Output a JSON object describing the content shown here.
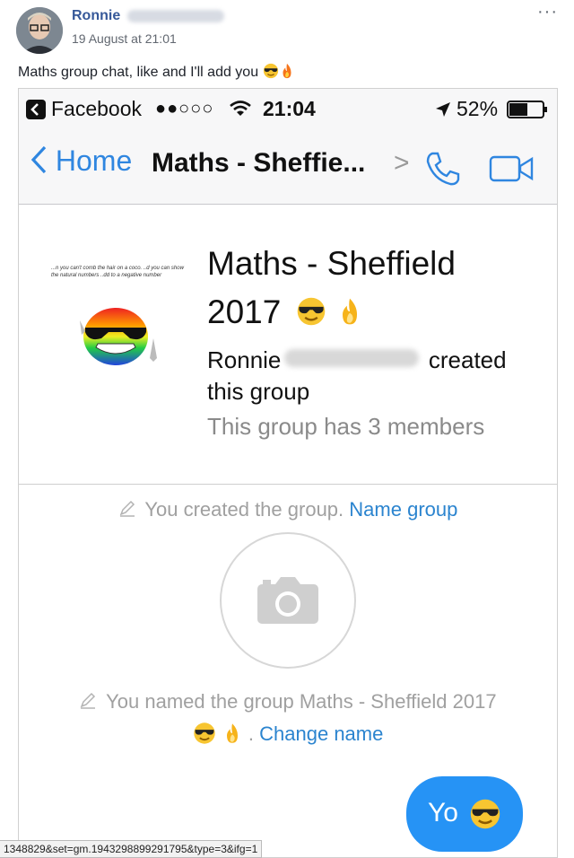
{
  "post": {
    "author": "Ronnie",
    "timestamp": "19 August at 21:01",
    "text": "Maths group chat, like and I'll add you",
    "more": "···"
  },
  "status_bar": {
    "back_app": "Facebook",
    "signal": "●●○○○",
    "time": "21:04",
    "battery": "52%"
  },
  "nav": {
    "back_label": "Home",
    "title": "Maths - Sheffie...",
    "chevron": ">"
  },
  "group": {
    "name_line1": "Maths - Sheffield",
    "name_line2": "2017",
    "creator_first": "Ronnie",
    "created_word": "created",
    "created_line2": "this group",
    "members": "This group has 3 members",
    "avatar_text": "...n you can't comb the hair on a coco. ..d you can show the natural numbers ..dd to a negative number"
  },
  "events": {
    "created_note": "You created the group.",
    "name_group_link": "Name group",
    "named_note": "You named the group Maths - Sheffield 2017",
    "change_name_link": "Change name",
    "change_name_prefix": "."
  },
  "message": {
    "text": "Yo"
  },
  "status_url": "1348829&set=gm.1943298899291795&type=3&ifg=1",
  "colors": {
    "link": "#2b84cf",
    "ios_blue": "#2f86e0",
    "bubble": "#2693f5",
    "fb_name": "#365899"
  }
}
